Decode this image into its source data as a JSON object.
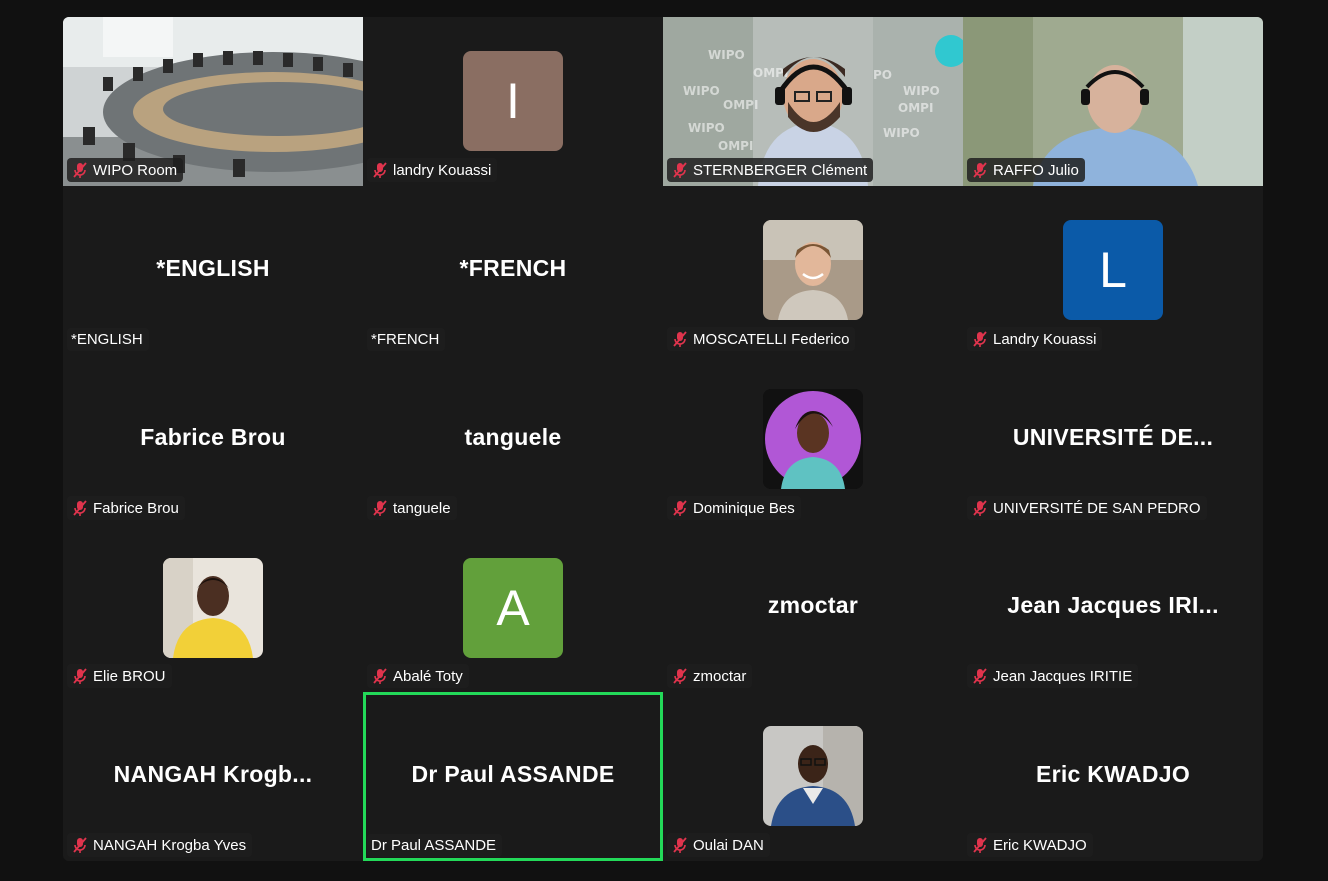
{
  "colors": {
    "speaking_border": "#23d959",
    "mute_icon": "#e0344d",
    "tile_bg": "#1a1a1a",
    "avatar_I": "#8a6e62",
    "avatar_L": "#0b5aa8",
    "avatar_A": "#62a03b"
  },
  "tiles": [
    {
      "label": "WIPO Room",
      "muted": true
    },
    {
      "label": "landry Kouassi",
      "muted": true,
      "avatar_letter": "I"
    },
    {
      "label": "STERNBERGER Clément",
      "muted": true
    },
    {
      "label": "RAFFO Julio",
      "muted": true
    },
    {
      "label": "*ENGLISH",
      "muted": false,
      "big_name": "*ENGLISH"
    },
    {
      "label": "*FRENCH",
      "muted": false,
      "big_name": "*FRENCH"
    },
    {
      "label": "MOSCATELLI Federico",
      "muted": true
    },
    {
      "label": "Landry Kouassi",
      "muted": true,
      "avatar_letter": "L"
    },
    {
      "label": "Fabrice Brou",
      "muted": true,
      "big_name": "Fabrice Brou"
    },
    {
      "label": "tanguele",
      "muted": true,
      "big_name": "tanguele"
    },
    {
      "label": "Dominique Bes",
      "muted": true
    },
    {
      "label": "UNIVERSITÉ DE SAN PEDRO",
      "muted": true,
      "big_name": "UNIVERSITÉ  DE..."
    },
    {
      "label": "Elie BROU",
      "muted": true
    },
    {
      "label": "Abalé Toty",
      "muted": true,
      "avatar_letter": "A"
    },
    {
      "label": "zmoctar",
      "muted": true,
      "big_name": "zmoctar"
    },
    {
      "label": "Jean Jacques IRITIE",
      "muted": true,
      "big_name": "Jean  Jacques  IRI..."
    },
    {
      "label": "NANGAH Krogba Yves",
      "muted": true,
      "big_name": "NANGAH  Krogb..."
    },
    {
      "label": "Dr Paul ASSANDE",
      "muted": false,
      "big_name": "Dr Paul ASSANDE",
      "speaking": true
    },
    {
      "label": "Oulai DAN",
      "muted": true
    },
    {
      "label": "Eric KWADJO",
      "muted": true,
      "big_name": "Eric KWADJO"
    }
  ]
}
